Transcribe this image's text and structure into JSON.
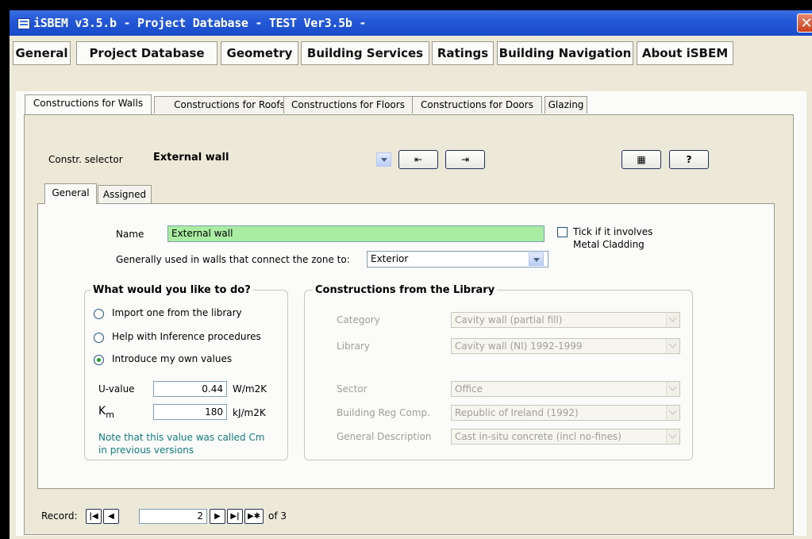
{
  "window": {
    "title": "iSBEM v3.5.b - Project Database - TEST Ver3.5b -"
  },
  "menu_tabs": [
    "General",
    "Project Database",
    "Geometry",
    "Building Services",
    "Ratings",
    "Building Navigation",
    "About iSBEM"
  ],
  "construction_tabs": [
    "Constructions for Walls",
    "Constructions for Roofs",
    "Constructions for Floors",
    "Constructions for Doors",
    "Glazing"
  ],
  "selector": {
    "label": "Constr. selector",
    "value": "External wall"
  },
  "sub_tabs": [
    "General",
    "Assigned"
  ],
  "form": {
    "name_label": "Name",
    "name_value": "External wall",
    "metal_cladding_label_1": "Tick if it involves",
    "metal_cladding_label_2": "Metal Cladding",
    "zone_label": "Generally used in walls that connect the zone to:",
    "zone_value": "Exterior"
  },
  "todo": {
    "title": "What would you like to do?",
    "options": [
      "Import one from the library",
      "Help with Inference procedures",
      "Introduce my own values"
    ],
    "selected_index": 2,
    "uvalue_label": "U-value",
    "uvalue": "0.44",
    "uvalue_unit": "W/m2K",
    "km_label": "K",
    "km_sub": "m",
    "km_value": "180",
    "km_unit": "kJ/m2K",
    "note_1": "Note that this value was called Cm",
    "note_2": "in previous versions"
  },
  "library": {
    "title": "Constructions from the Library",
    "category_label": "Category",
    "category_value": "Cavity wall (partial fill)",
    "library_label": "Library",
    "library_value": "Cavity wall (NI) 1992-1999",
    "sector_label": "Sector",
    "sector_value": "Office",
    "bldg_reg_label": "Building Reg Comp.",
    "bldg_reg_value": "Republic of Ireland (1992)",
    "gen_desc_label": "General Description",
    "gen_desc_value": "Cast in-situ concrete (incl no-fines)"
  },
  "record_nav": {
    "label": "Record:",
    "current": "2",
    "of_label": "of 3"
  },
  "colors": {
    "titlebar": "#2458d8",
    "name_field": "#a8eda2",
    "note_text": "#117e7e"
  }
}
